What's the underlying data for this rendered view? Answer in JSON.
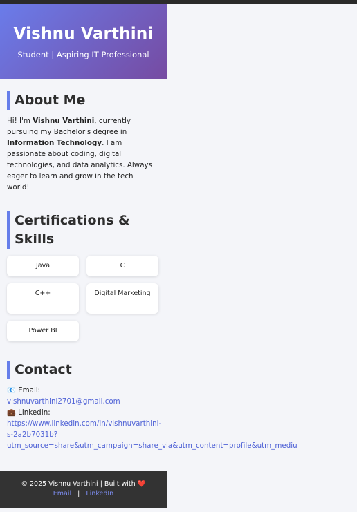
{
  "header": {
    "name": "Vishnu Varthini",
    "tagline": "Student | Aspiring IT Professional"
  },
  "about": {
    "title": "About Me",
    "text_1": "Hi! I'm ",
    "name_bold": "Vishnu Varthini",
    "text_2": ", currently pursuing my Bachelor's degree in ",
    "degree_bold": "Information Technology",
    "text_3": ". I am passionate about coding, digital technologies, and data analytics. Always eager to learn and grow in the tech world!"
  },
  "certifications": {
    "title": "Certifications & Skills",
    "items": [
      "Java",
      "C",
      "C++",
      "Digital Marketing",
      "Power BI"
    ]
  },
  "contact": {
    "title": "Contact",
    "email_icon": "📧",
    "email_label": "Email:",
    "email_value": "vishnuvarthini2701@gmail.com",
    "linkedin_icon": "💼",
    "linkedin_label": "LinkedIn:",
    "linkedin_line_1": "https://www.linkedin.com/in/vishnuvarthini-",
    "linkedin_line_2": "s-2a2b7031b?",
    "linkedin_line_3": "utm_source=share&utm_campaign=share_via&utm_content=profile&utm_mediu"
  },
  "footer": {
    "copyright": "© 2025 Vishnu Varthini | Built with",
    "heart": "❤️",
    "email_link": "Email",
    "separator": "|",
    "linkedin_link": "LinkedIn"
  },
  "colors": {
    "accent": "#667eea",
    "gradient_end": "#764ba2",
    "link": "#4f62d6",
    "footer_bg": "#333333"
  }
}
